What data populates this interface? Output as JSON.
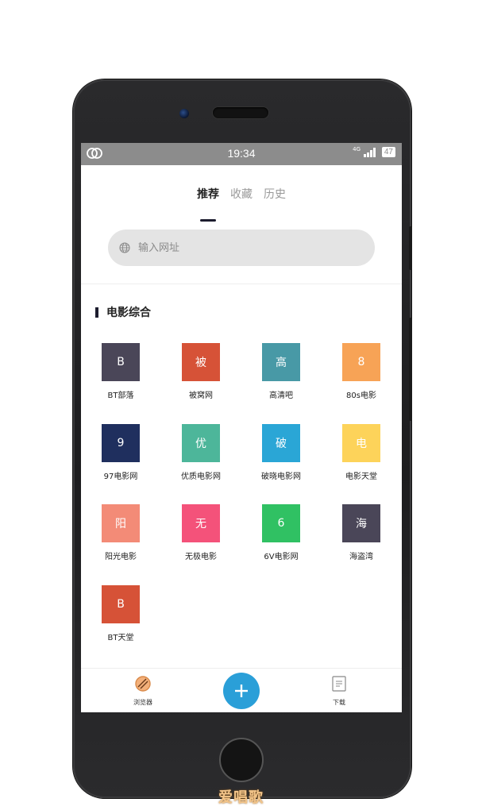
{
  "statusbar": {
    "time": "19:34",
    "network": "4G",
    "battery": "47"
  },
  "tabs": [
    {
      "label": "推荐",
      "active": true
    },
    {
      "label": "收藏",
      "active": false
    },
    {
      "label": "历史",
      "active": false
    }
  ],
  "search": {
    "placeholder": "输入网址",
    "icon": "globe-icon"
  },
  "section": {
    "title": "电影综合"
  },
  "sites": [
    {
      "glyph": "B",
      "label": "BT部落",
      "color": "#4a4658"
    },
    {
      "glyph": "被",
      "label": "被窝网",
      "color": "#d65237"
    },
    {
      "glyph": "高",
      "label": "高清吧",
      "color": "#4899a6"
    },
    {
      "glyph": "8",
      "label": "80s电影",
      "color": "#f7a356"
    },
    {
      "glyph": "9",
      "label": "97电影网",
      "color": "#1f2f5e"
    },
    {
      "glyph": "优",
      "label": "优质电影网",
      "color": "#4db69a"
    },
    {
      "glyph": "破",
      "label": "破晓电影网",
      "color": "#2aa6d6"
    },
    {
      "glyph": "电",
      "label": "电影天堂",
      "color": "#fdd35a"
    },
    {
      "glyph": "阳",
      "label": "阳光电影",
      "color": "#f38b77"
    },
    {
      "glyph": "无",
      "label": "无极电影",
      "color": "#f4527a"
    },
    {
      "glyph": "6",
      "label": "6V电影网",
      "color": "#30c163"
    },
    {
      "glyph": "海",
      "label": "海盗湾",
      "color": "#4a4658"
    },
    {
      "glyph": "B",
      "label": "BT天堂",
      "color": "#d65237"
    }
  ],
  "bottom_nav": {
    "browser_label": "浏览器",
    "download_label": "下载",
    "fab_color": "#2a9fd8"
  },
  "watermark": "爱唱歌"
}
